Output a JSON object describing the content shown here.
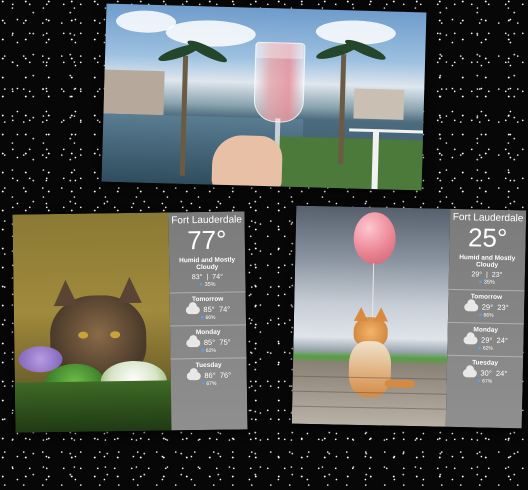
{
  "weather_left": {
    "city": "Fort Lauderdale",
    "temp": "77°",
    "condition": "Humid and Mostly Cloudy",
    "high": "83°",
    "low": "74°",
    "precip": "35%",
    "forecast": [
      {
        "day": "Tomorrow",
        "high": "85°",
        "low": "74°",
        "precip": "66%"
      },
      {
        "day": "Monday",
        "high": "85°",
        "low": "75°",
        "precip": "62%"
      },
      {
        "day": "Tuesday",
        "high": "86°",
        "low": "76°",
        "precip": "67%"
      }
    ]
  },
  "weather_right": {
    "city": "Fort Lauderdale",
    "temp": "25°",
    "condition": "Humid and Mostly Cloudy",
    "high": "29°",
    "low": "23°",
    "precip": "35%",
    "forecast": [
      {
        "day": "Tomorrow",
        "high": "29°",
        "low": "23°",
        "precip": "66%"
      },
      {
        "day": "Monday",
        "high": "29°",
        "low": "24°",
        "precip": "62%"
      },
      {
        "day": "Tuesday",
        "high": "30°",
        "low": "24°",
        "precip": "67%"
      }
    ]
  }
}
